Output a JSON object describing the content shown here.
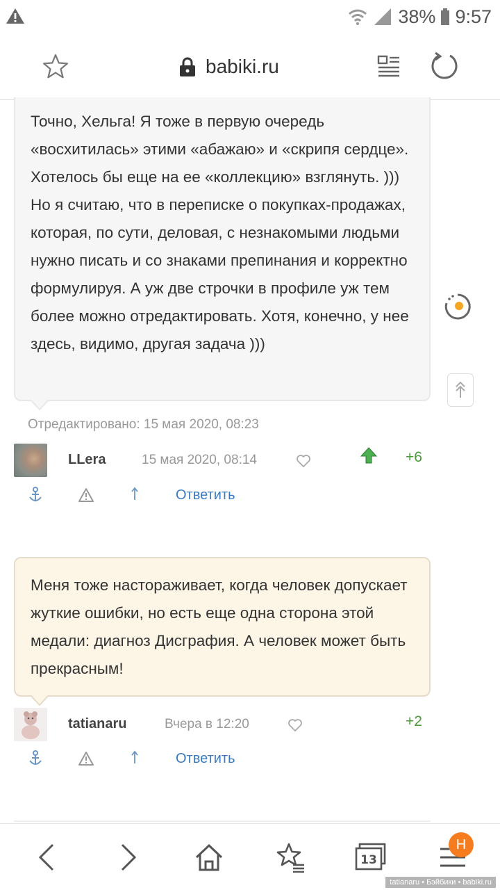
{
  "status_bar": {
    "battery": "38%",
    "time": "9:57",
    "warning_icon": "warning-triangle-icon",
    "wifi_icon": "wifi-question-icon",
    "signal_icon": "cell-signal-icon"
  },
  "browser": {
    "url": "babiki.ru",
    "icons": [
      "star-icon",
      "lock-icon",
      "reader-mode-icon",
      "reload-icon"
    ]
  },
  "comments": [
    {
      "text": "Точно, Хельга! Я тоже в первую очередь «восхитилась» этими «абажаю» и «скрипя сердце». Хотелось бы еще на ее «коллекцию» взглянуть. ))) Но я считаю, что в переписке о покупках-продажах, которая, по сути, деловая, с незнакомыми людьми нужно писать и со знаками препинания и корректно формулируя. А уж две строчки в профиле уж тем более можно отредактировать. Хотя, конечно, у нее здесь, видимо, другая задача )))",
      "edited": "Отредактировано: 15 мая 2020, 08:23",
      "author": "LLera",
      "date": "15 мая 2020, 08:14",
      "score": "+6",
      "reply_label": "Ответить"
    },
    {
      "text": "Меня тоже настораживает, когда человек допускает жуткие ошибки, но есть еще одна сторона этой медали: диагноз Дисграфия. А человек может быть прекрасным!",
      "author": "tatianaru",
      "date": "Вчера в 12:20",
      "score": "+2",
      "reply_label": "Ответить"
    }
  ],
  "colors": {
    "bubble_grey": "#f6f6f6",
    "bubble_cream": "#fdf5e6",
    "score_green": "#4d9a3c",
    "link_blue": "#3a7bbf",
    "badge_orange": "#f57c1f"
  },
  "bottom_nav": {
    "tabs_count": "13",
    "notification_badge": "H",
    "icons": [
      "back-icon",
      "forward-icon",
      "home-icon",
      "bookmarks-icon",
      "tabs-icon",
      "menu-icon"
    ]
  },
  "watermark": "tatianaru • Бэйбики • babiki.ru"
}
